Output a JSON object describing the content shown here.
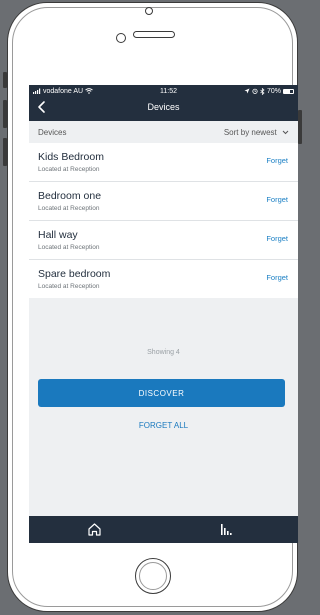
{
  "status_bar": {
    "carrier": "vodafone AU",
    "time": "11:52",
    "battery": "70%"
  },
  "nav": {
    "back_icon": "chevron-left-icon",
    "title": "Devices"
  },
  "list_header": {
    "label": "Devices",
    "sort_label": "Sort by newest"
  },
  "devices": [
    {
      "name": "Kids Bedroom",
      "location": "Located at Reception",
      "action": "Forget"
    },
    {
      "name": "Bedroom one",
      "location": "Located at Reception",
      "action": "Forget"
    },
    {
      "name": "Hall way",
      "location": "Located at Reception",
      "action": "Forget"
    },
    {
      "name": "Spare bedroom",
      "location": "Located at Reception",
      "action": "Forget"
    }
  ],
  "showing_text": "Showing 4",
  "discover_label": "DISCOVER",
  "forget_all_label": "FORGET ALL",
  "tab_bar": {
    "items": [
      {
        "icon": "home-icon"
      },
      {
        "icon": "activity-icon"
      }
    ]
  },
  "colors": {
    "header_bg": "#232f3e",
    "accent": "#1a79be",
    "list_bg": "#eef0f2"
  }
}
